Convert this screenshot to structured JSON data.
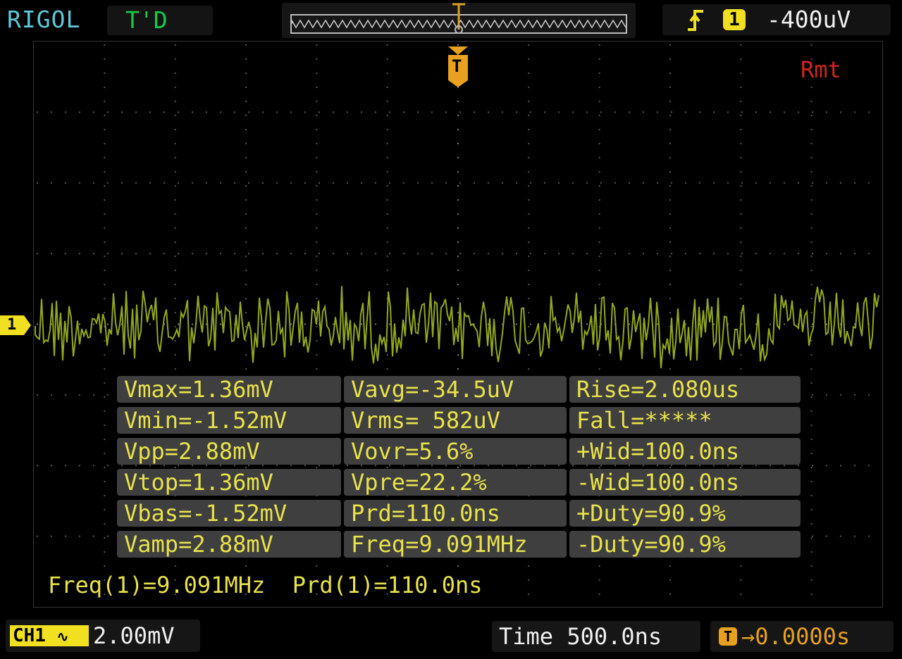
{
  "header": {
    "brand": "RIGOL",
    "status": "T'D",
    "trigger": {
      "edge_icon": "rising-edge-icon",
      "source": "1",
      "level": "-400uV"
    }
  },
  "screen": {
    "remote_indicator": "Rmt",
    "trigger_marker": "T",
    "channel_marker": "1",
    "trace_color": "#8fa81c"
  },
  "measurements": [
    [
      "Vmax=1.36mV",
      "Vavg=-34.5uV",
      "Rise=2.080us"
    ],
    [
      "Vmin=-1.52mV",
      "Vrms= 582uV",
      "Fall=*****"
    ],
    [
      "Vpp=2.88mV",
      "Vovr=5.6%",
      "+Wid=100.0ns"
    ],
    [
      "Vtop=1.36mV",
      "Vpre=22.2%",
      "-Wid=100.0ns"
    ],
    [
      "Vbas=-1.52mV",
      "Prd=110.0ns",
      "+Duty=90.9%"
    ],
    [
      "Vamp=2.88mV",
      "Freq=9.091MHz",
      "-Duty=90.9%"
    ]
  ],
  "readout": {
    "freq": "Freq(1)=9.091MHz",
    "prd": "Prd(1)=110.0ns"
  },
  "footer": {
    "ch1_label": "CH1",
    "coupling_icon": "ac-coupling-icon",
    "ch1_scale": "2.00mV",
    "time_label": "Time",
    "time_value": "500.0ns",
    "trigger_position": "0.0000s"
  }
}
